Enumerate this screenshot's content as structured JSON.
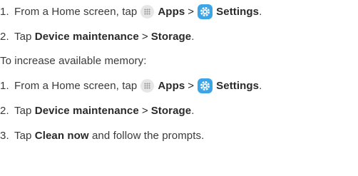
{
  "steps_a": [
    {
      "num": "1.",
      "pre": "From a Home screen, tap",
      "apps": "Apps",
      "arrow": ">",
      "settings": "Settings",
      "end": "."
    },
    {
      "num": "2.",
      "pre": "Tap",
      "dm": "Device maintenance",
      "arrow": ">",
      "storage": "Storage",
      "end": "."
    }
  ],
  "intro": "To increase available memory:",
  "steps_b": [
    {
      "num": "1.",
      "pre": "From a Home screen, tap",
      "apps": "Apps",
      "arrow": ">",
      "settings": "Settings",
      "end": "."
    },
    {
      "num": "2.",
      "pre": "Tap",
      "dm": "Device maintenance",
      "arrow": ">",
      "storage": "Storage",
      "end": "."
    },
    {
      "num": "3.",
      "pre": "Tap",
      "clean": "Clean now",
      "post": "and follow the prompts."
    }
  ],
  "icons": {
    "apps_icon": "apps-grid-icon",
    "settings_icon": "settings-gear-icon",
    "settings_color": "#3da4e6",
    "apps_bg": "#e6e6e6"
  }
}
